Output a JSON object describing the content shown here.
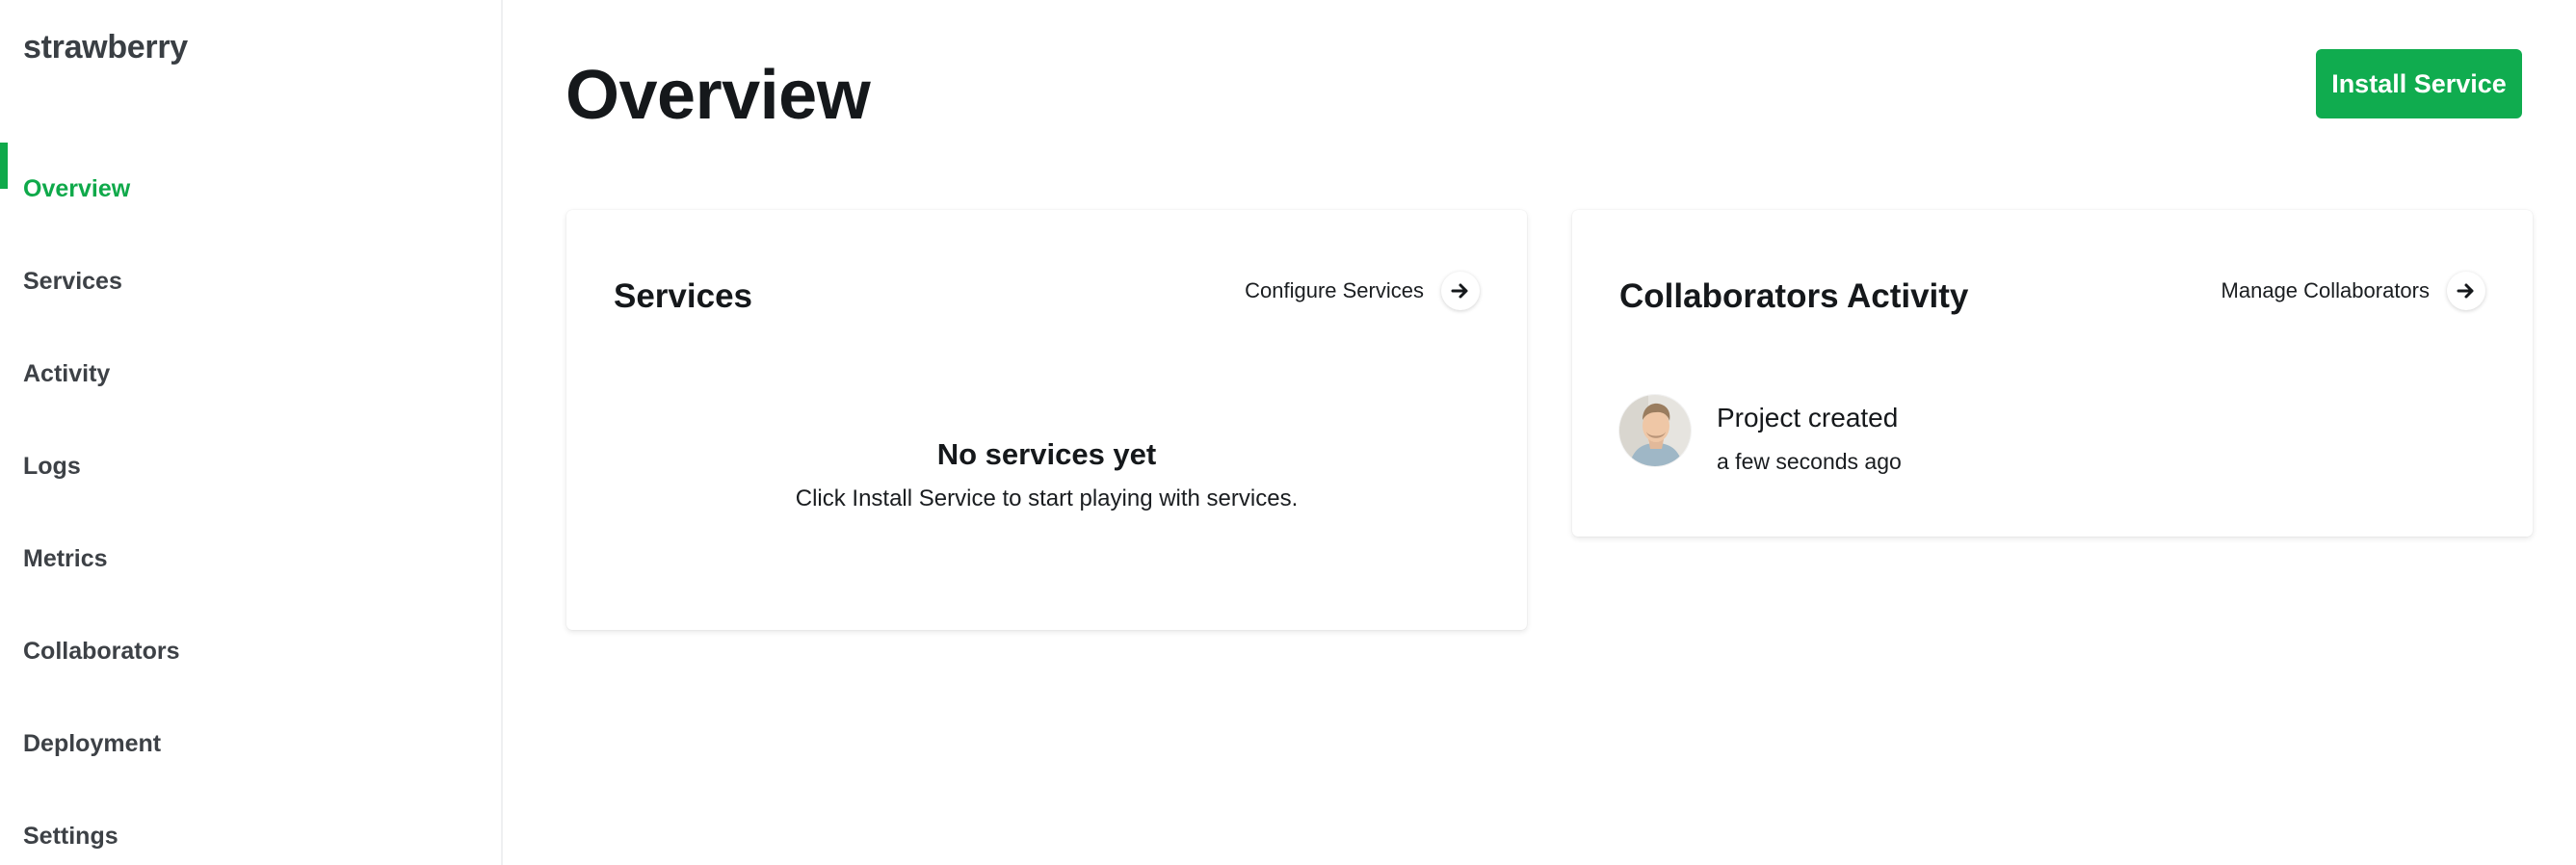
{
  "app": {
    "brand": "strawberry"
  },
  "sidebar": {
    "active_color": "#0fa94a",
    "items": [
      {
        "label": "Overview",
        "active": true
      },
      {
        "label": "Services"
      },
      {
        "label": "Activity"
      },
      {
        "label": "Logs"
      },
      {
        "label": "Metrics"
      },
      {
        "label": "Collaborators"
      },
      {
        "label": "Deployment"
      },
      {
        "label": "Settings"
      }
    ]
  },
  "header": {
    "title": "Overview",
    "install_button": "Install Service",
    "install_button_color": "#10ac4f"
  },
  "services_card": {
    "title": "Services",
    "link_label": "Configure Services",
    "link_icon": "arrow-right-icon",
    "empty_title": "No services yet",
    "empty_description": "Click Install Service to start playing with services."
  },
  "collaborators_card": {
    "title": "Collaborators Activity",
    "link_label": "Manage Collaborators",
    "link_icon": "arrow-right-icon",
    "activity": [
      {
        "avatar_icon": "user-avatar",
        "title": "Project created",
        "time": "a few seconds ago"
      }
    ]
  }
}
